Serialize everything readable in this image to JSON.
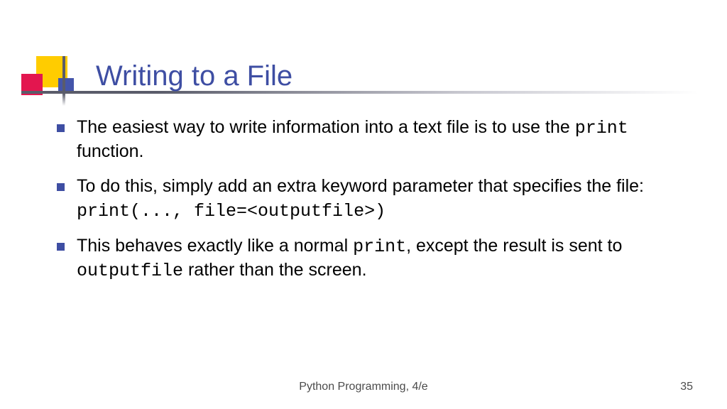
{
  "title": "Writing to a File",
  "bullets": {
    "b1": {
      "t1": "The easiest way to write information into a text file is to use the ",
      "code1": "print",
      "t2": " function."
    },
    "b2": {
      "t1": "To do this, simply add an extra keyword parameter that specifies the file:",
      "code_line": "print(..., file=<outputfile>)"
    },
    "b3": {
      "t1": "This behaves exactly like a normal ",
      "code1": "print",
      "t2": ", except the result is sent to ",
      "code2": "outputfile",
      "t3": " rather than the screen."
    }
  },
  "footer": {
    "book": "Python Programming, 4/e",
    "page": "35"
  }
}
